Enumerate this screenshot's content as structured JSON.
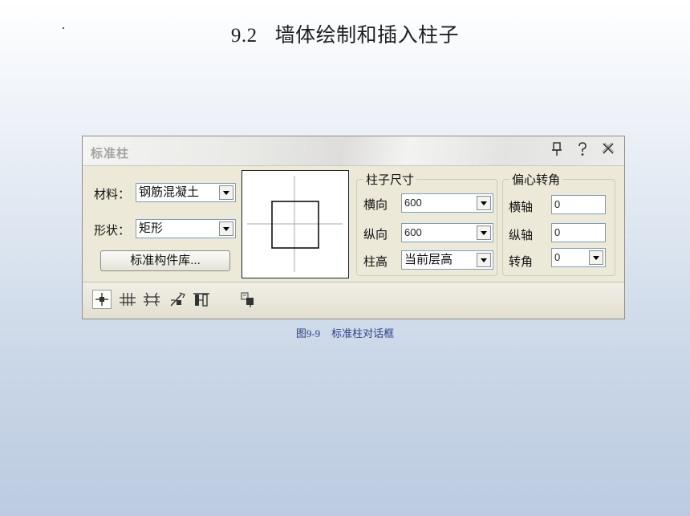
{
  "slide": {
    "section_number": "9.2",
    "title": "墙体绘制和插入柱子",
    "caption_number": "图9-9",
    "caption_text": "标准柱对话框"
  },
  "dialog": {
    "title": "标准柱",
    "titlebar_icons": [
      "pin-icon",
      "help-icon",
      "close-icon"
    ],
    "titlebar_glyphs": [
      "ὌC",
      "?",
      "✕"
    ],
    "material_label": "材料：",
    "material_value": "钢筋混凝土",
    "shape_label": "形状：",
    "shape_value": "矩形",
    "library_button": "标准构件库...",
    "size_group": {
      "title": "柱子尺寸",
      "horizontal_label": "横向",
      "horizontal_value": "600",
      "vertical_label": "纵向",
      "vertical_value": "600",
      "height_label": "柱高",
      "height_value": "当前层高"
    },
    "offset_group": {
      "title": "偏心转角",
      "x_axis_label": "横轴",
      "x_axis_value": "0",
      "y_axis_label": "纵轴",
      "y_axis_value": "0",
      "rotation_label": "转角",
      "rotation_value": "0"
    },
    "toolbar_tools": [
      "point-insert-icon",
      "axis-intersection-icon",
      "area-grid-icon",
      "replace-column-icon",
      "pick-column-icon",
      "copy-column-icon"
    ]
  }
}
